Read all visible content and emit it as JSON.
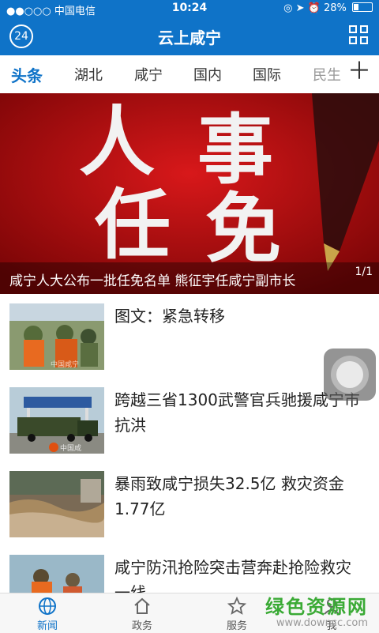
{
  "status": {
    "carrier": "●●○○○ 中国电信",
    "time": "10:24",
    "battery": "28%",
    "battery_level": 0.28
  },
  "header": {
    "logo_text": "24",
    "title": "云上咸宁"
  },
  "tabs": [
    {
      "label": "头条",
      "active": true
    },
    {
      "label": "湖北"
    },
    {
      "label": "咸宁"
    },
    {
      "label": "国内"
    },
    {
      "label": "国际"
    },
    {
      "label": "民生"
    }
  ],
  "banner": {
    "image_text": [
      "人",
      "事",
      "任",
      "免"
    ],
    "caption": "咸宁人大公布一批任免名单 熊征宇任咸宁副市长",
    "pager": "1/1"
  },
  "news": [
    {
      "title": "图文：紧急转移",
      "thumb_watermark": "中国咸宁"
    },
    {
      "title": "跨越三省1300武警官兵驰援咸宁市抗洪",
      "thumb_watermark": "中国咸"
    },
    {
      "title": "暴雨致咸宁损失32.5亿 救灾资金1.77亿"
    },
    {
      "title": "咸宁防汛抢险突击营奔赴抢险救灾一线"
    }
  ],
  "bottom_nav": [
    {
      "label": "新闻",
      "icon": "globe-icon",
      "active": true
    },
    {
      "label": "政务",
      "icon": "home-icon"
    },
    {
      "label": "服务",
      "icon": "star-icon"
    },
    {
      "label": "我",
      "icon": "user-icon"
    }
  ],
  "watermark": {
    "line1": "绿色资源网",
    "line2": "www.downcc.com"
  },
  "colors": {
    "primary": "#0f73c8",
    "banner_red": "#b01012"
  }
}
